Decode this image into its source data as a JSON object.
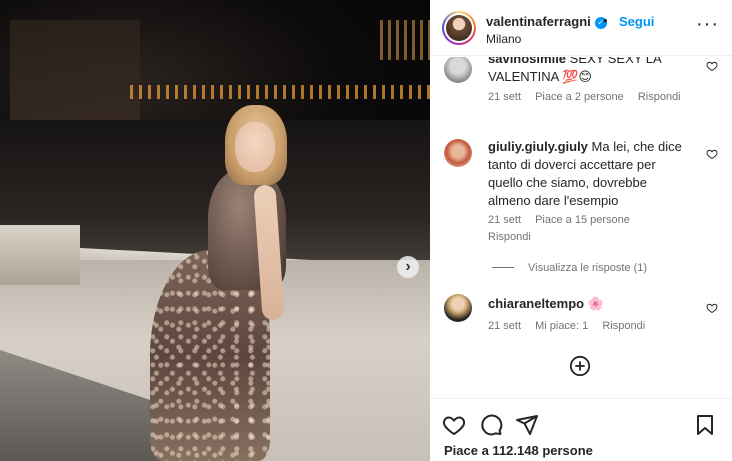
{
  "header": {
    "username": "valentinaferragni",
    "separator": "•",
    "follow_label": "Segui",
    "location": "Milano",
    "more_label": "···"
  },
  "comments": [
    {
      "username": "savinosimile",
      "text_partial": "SEXY SEXY LA",
      "text_line2": "VALENTINA",
      "emoji": "💯😊",
      "time": "21 sett",
      "likes": "Piace a 2 persone",
      "reply": "Rispondi"
    },
    {
      "username": "giuliy.giuly.giuly",
      "text": "Ma lei, che dice",
      "line2": "tanto di doverci accettare per",
      "line3": "quello che siamo, dovrebbe",
      "line4": "almeno dare l'esempio",
      "time": "21 sett",
      "likes": "Piace a 15 persone",
      "reply": "Rispondi"
    },
    {
      "username": "chiaraneltempo",
      "emoji": "🌸",
      "time": "21 sett",
      "likes": "Mi piace: 1",
      "reply": "Rispondi"
    }
  ],
  "view_replies": "Visualizza le risposte (1)",
  "likes_count": "Piace a 112.148 persone",
  "colors": {
    "accent": "#0095f6",
    "text": "#262626",
    "secondary": "#737373"
  }
}
